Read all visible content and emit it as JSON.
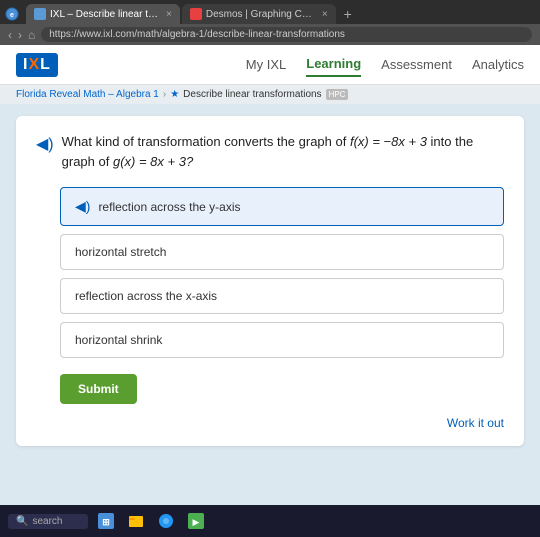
{
  "browser": {
    "tabs": [
      {
        "id": "tab1",
        "title": "IXL – Describe linear transformati",
        "favicon_color": "#5b9bd5",
        "active": true,
        "close_label": "×"
      },
      {
        "id": "tab2",
        "title": "Desmos | Graphing Calculator",
        "favicon_color": "#e84040",
        "active": false,
        "close_label": "×"
      }
    ],
    "new_tab_label": "+",
    "address": "https://www.ixl.com/math/algebra-1/describe-linear-transformations",
    "nav_back": "‹",
    "nav_forward": "›",
    "nav_home": "⌂"
  },
  "header": {
    "logo_text_i": "I",
    "logo_text_xl": "XL",
    "nav_items": [
      {
        "label": "My IXL",
        "active": false
      },
      {
        "label": "Learning",
        "active": true
      },
      {
        "label": "Assessment",
        "active": false
      },
      {
        "label": "Analytics",
        "active": false
      }
    ]
  },
  "breadcrumb": {
    "items": [
      {
        "label": "Florida Reveal Math – Algebra 1",
        "link": true
      },
      {
        "label": "Describe linear transformations",
        "link": false
      }
    ],
    "badge": "HPC"
  },
  "question": {
    "speaker_symbol": "◀)",
    "text_prefix": "What kind of transformation converts the graph of",
    "fx": "f(x) = −8x + 3",
    "text_mid": "into the graph of",
    "gx": "g(x) = 8x + 3?",
    "options": [
      {
        "id": "opt1",
        "label": "reflection across the y-axis",
        "selected": true,
        "speaker_symbol": "◀)"
      },
      {
        "id": "opt2",
        "label": "horizontal stretch",
        "selected": false
      },
      {
        "id": "opt3",
        "label": "reflection across the x-axis",
        "selected": false
      },
      {
        "id": "opt4",
        "label": "horizontal shrink",
        "selected": false
      }
    ]
  },
  "buttons": {
    "submit_label": "Submit",
    "work_it_out_label": "Work it out"
  },
  "taskbar": {
    "search_placeholder": "search"
  }
}
